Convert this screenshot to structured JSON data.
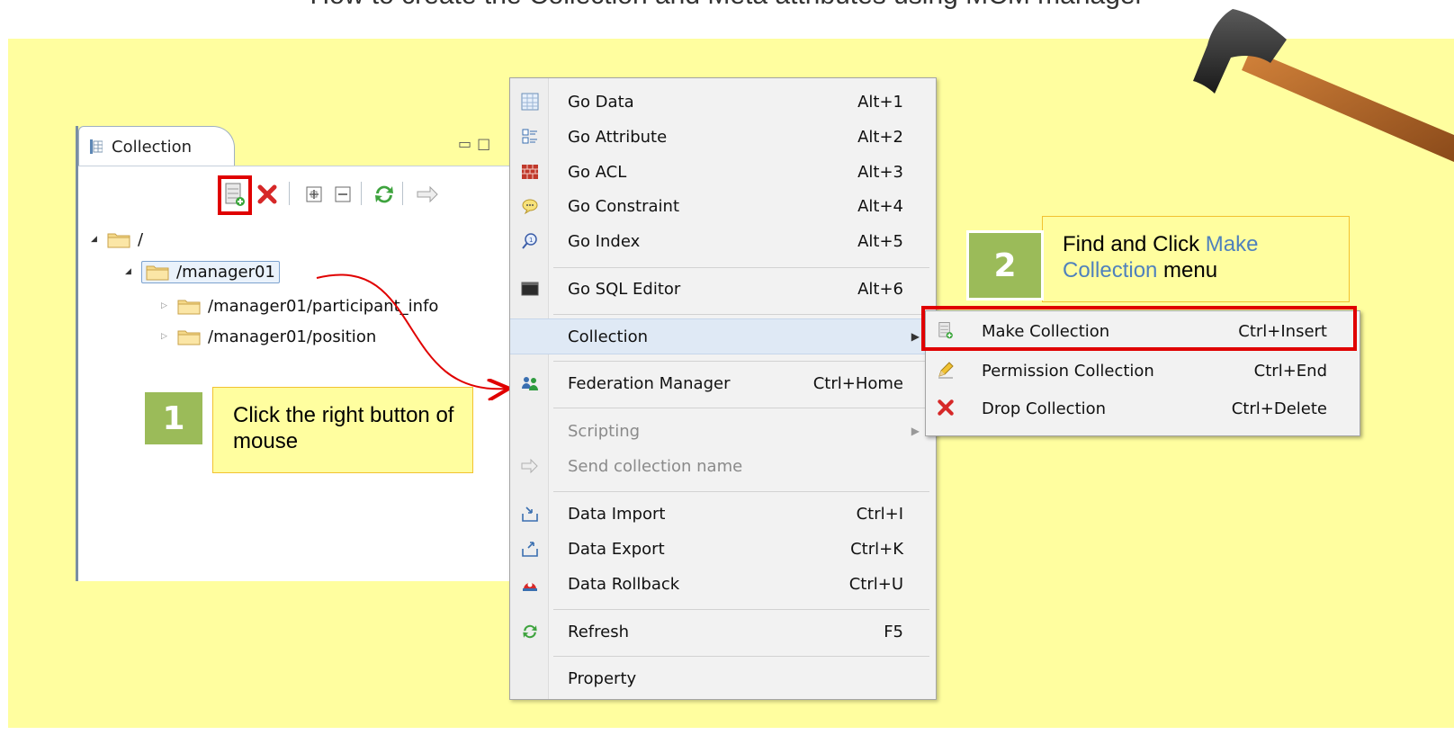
{
  "header_clip": "How to create the Collection and Meta attributes using MCM manager",
  "colors": {
    "background": "#fffe9f",
    "highlight": "#e00000",
    "step_badge": "#9bbb59",
    "accent_link": "#4f81bd"
  },
  "panel": {
    "tab_title": "Collection",
    "toolbar": [
      "make-collection-icon",
      "delete-icon",
      "expand-all-icon",
      "collapse-all-icon",
      "refresh-icon",
      "send-icon"
    ],
    "tree": [
      {
        "label": "/",
        "level": 0
      },
      {
        "label": "/manager01",
        "level": 1
      },
      {
        "label": "/manager01/participant_info",
        "level": 2
      },
      {
        "label": "/manager01/position",
        "level": 2
      }
    ]
  },
  "menu": {
    "items": [
      {
        "label": "Go Data",
        "shortcut": "Alt+1",
        "icon": "table-icon"
      },
      {
        "label": "Go Attribute",
        "shortcut": "Alt+2",
        "icon": "attribute-icon"
      },
      {
        "label": "Go ACL",
        "shortcut": "Alt+3",
        "icon": "brick-wall-icon"
      },
      {
        "label": "Go Constraint",
        "shortcut": "Alt+4",
        "icon": "speech-bubble-icon"
      },
      {
        "label": "Go Index",
        "shortcut": "Alt+5",
        "icon": "magnifier-icon"
      },
      {
        "label": "Go SQL Editor",
        "shortcut": "Alt+6",
        "icon": "terminal-icon"
      },
      {
        "label": "Collection",
        "shortcut": "",
        "icon": ""
      },
      {
        "label": "Federation Manager",
        "shortcut": "Ctrl+Home",
        "icon": "users-icon"
      },
      {
        "label": "Scripting",
        "shortcut": "",
        "icon": ""
      },
      {
        "label": "Send collection name",
        "shortcut": "",
        "icon": "send-icon"
      },
      {
        "label": "Data Import",
        "shortcut": "Ctrl+I",
        "icon": "import-icon"
      },
      {
        "label": "Data Export",
        "shortcut": "Ctrl+K",
        "icon": "export-icon"
      },
      {
        "label": "Data Rollback",
        "shortcut": "Ctrl+U",
        "icon": "rollback-icon"
      },
      {
        "label": "Refresh",
        "shortcut": "F5",
        "icon": "refresh-icon"
      },
      {
        "label": "Property",
        "shortcut": "",
        "icon": ""
      }
    ]
  },
  "submenu": {
    "items": [
      {
        "label": "Make Collection",
        "shortcut": "Ctrl+Insert",
        "icon": "make-collection-icon"
      },
      {
        "label": "Permission Collection",
        "shortcut": "Ctrl+End",
        "icon": "pencil-icon"
      },
      {
        "label": "Drop Collection",
        "shortcut": "Ctrl+Delete",
        "icon": "delete-icon"
      }
    ]
  },
  "steps": [
    {
      "number": "1",
      "text": "Click the right button of mouse"
    },
    {
      "number": "2",
      "text_before": "Find and Click ",
      "text_accent": "Make Collection",
      "text_after": " menu"
    }
  ]
}
